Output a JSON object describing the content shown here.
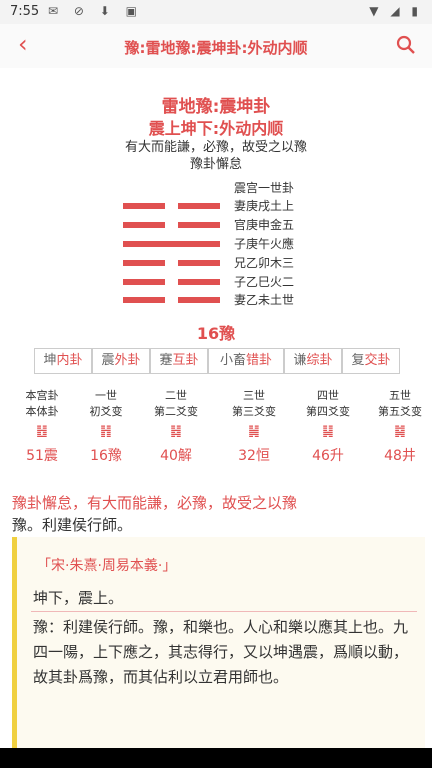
{
  "status": {
    "time": "7:55"
  },
  "header": {
    "title": "豫:雷地豫:震坤卦:外动内顺"
  },
  "hexagram": {
    "name": "雷地豫:震坤卦",
    "sub": "震上坤下:外动内顺",
    "desc": "有大而能謙，必豫，故受之以豫",
    "desc2": "豫卦懈怠",
    "palace": "震宫一世卦",
    "lines": [
      "妻庚戌土上",
      "官庚申金五",
      "子庚午火應",
      "兄乙卯木三",
      "子乙巳火二",
      "妻乙未土世"
    ],
    "number": "16豫"
  },
  "related": [
    {
      "a": "坤",
      "b": "内卦"
    },
    {
      "a": "震",
      "b": "外卦"
    },
    {
      "a": "蹇",
      "b": "互卦"
    },
    {
      "a": "小畜",
      "b": "错卦"
    },
    {
      "a": "谦",
      "b": "综卦"
    },
    {
      "a": "复",
      "b": "交卦"
    }
  ],
  "generations": [
    {
      "t1": "本宫卦",
      "t2": "本体卦",
      "sym": "䷲",
      "name": "51震"
    },
    {
      "t1": "一世",
      "t2": "初爻变",
      "sym": "䷏",
      "name": "16豫"
    },
    {
      "t1": "二世",
      "t2": "第二爻变",
      "sym": "䷧",
      "name": "40解"
    },
    {
      "t1": "三世",
      "t2": "第三爻变",
      "sym": "䷟",
      "name": "32恒"
    },
    {
      "t1": "四世",
      "t2": "第四爻变",
      "sym": "䷭",
      "name": "46升"
    },
    {
      "t1": "五世",
      "t2": "第五爻变",
      "sym": "䷯",
      "name": "48井"
    }
  ],
  "text": {
    "p1": "豫卦懈怠，有大而能謙，必豫，故受之以豫",
    "p2": "豫。利建侯行師。"
  },
  "commentary": {
    "source": "「宋·朱熹·周易本義·」",
    "head": "坤下，震上。",
    "body": "豫：利建侯行師。豫，和樂也。人心和樂以應其上也。九四一陽，上下應之，其志得行，又以坤遇震，爲順以動，故其卦爲豫，而其佔利以立君用師也。"
  },
  "colors": {
    "accent": "#e05050",
    "quote_border": "#f0d040"
  },
  "icons": {
    "back": "chevron-left-icon",
    "search": "search-icon"
  }
}
